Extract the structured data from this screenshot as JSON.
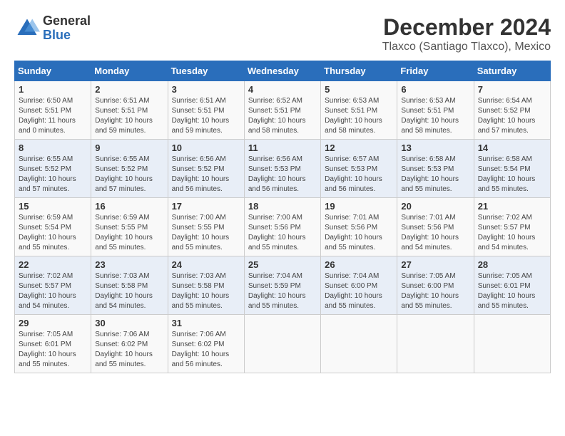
{
  "logo": {
    "general": "General",
    "blue": "Blue"
  },
  "title": "December 2024",
  "subtitle": "Tlaxco (Santiago Tlaxco), Mexico",
  "calendar": {
    "headers": [
      "Sunday",
      "Monday",
      "Tuesday",
      "Wednesday",
      "Thursday",
      "Friday",
      "Saturday"
    ],
    "weeks": [
      [
        {
          "day": "1",
          "sunrise": "6:50 AM",
          "sunset": "5:51 PM",
          "daylight": "11 hours and 0 minutes."
        },
        {
          "day": "2",
          "sunrise": "6:51 AM",
          "sunset": "5:51 PM",
          "daylight": "10 hours and 59 minutes."
        },
        {
          "day": "3",
          "sunrise": "6:51 AM",
          "sunset": "5:51 PM",
          "daylight": "10 hours and 59 minutes."
        },
        {
          "day": "4",
          "sunrise": "6:52 AM",
          "sunset": "5:51 PM",
          "daylight": "10 hours and 58 minutes."
        },
        {
          "day": "5",
          "sunrise": "6:53 AM",
          "sunset": "5:51 PM",
          "daylight": "10 hours and 58 minutes."
        },
        {
          "day": "6",
          "sunrise": "6:53 AM",
          "sunset": "5:51 PM",
          "daylight": "10 hours and 58 minutes."
        },
        {
          "day": "7",
          "sunrise": "6:54 AM",
          "sunset": "5:52 PM",
          "daylight": "10 hours and 57 minutes."
        }
      ],
      [
        {
          "day": "8",
          "sunrise": "6:55 AM",
          "sunset": "5:52 PM",
          "daylight": "10 hours and 57 minutes."
        },
        {
          "day": "9",
          "sunrise": "6:55 AM",
          "sunset": "5:52 PM",
          "daylight": "10 hours and 57 minutes."
        },
        {
          "day": "10",
          "sunrise": "6:56 AM",
          "sunset": "5:52 PM",
          "daylight": "10 hours and 56 minutes."
        },
        {
          "day": "11",
          "sunrise": "6:56 AM",
          "sunset": "5:53 PM",
          "daylight": "10 hours and 56 minutes."
        },
        {
          "day": "12",
          "sunrise": "6:57 AM",
          "sunset": "5:53 PM",
          "daylight": "10 hours and 56 minutes."
        },
        {
          "day": "13",
          "sunrise": "6:58 AM",
          "sunset": "5:53 PM",
          "daylight": "10 hours and 55 minutes."
        },
        {
          "day": "14",
          "sunrise": "6:58 AM",
          "sunset": "5:54 PM",
          "daylight": "10 hours and 55 minutes."
        }
      ],
      [
        {
          "day": "15",
          "sunrise": "6:59 AM",
          "sunset": "5:54 PM",
          "daylight": "10 hours and 55 minutes."
        },
        {
          "day": "16",
          "sunrise": "6:59 AM",
          "sunset": "5:55 PM",
          "daylight": "10 hours and 55 minutes."
        },
        {
          "day": "17",
          "sunrise": "7:00 AM",
          "sunset": "5:55 PM",
          "daylight": "10 hours and 55 minutes."
        },
        {
          "day": "18",
          "sunrise": "7:00 AM",
          "sunset": "5:56 PM",
          "daylight": "10 hours and 55 minutes."
        },
        {
          "day": "19",
          "sunrise": "7:01 AM",
          "sunset": "5:56 PM",
          "daylight": "10 hours and 55 minutes."
        },
        {
          "day": "20",
          "sunrise": "7:01 AM",
          "sunset": "5:56 PM",
          "daylight": "10 hours and 54 minutes."
        },
        {
          "day": "21",
          "sunrise": "7:02 AM",
          "sunset": "5:57 PM",
          "daylight": "10 hours and 54 minutes."
        }
      ],
      [
        {
          "day": "22",
          "sunrise": "7:02 AM",
          "sunset": "5:57 PM",
          "daylight": "10 hours and 54 minutes."
        },
        {
          "day": "23",
          "sunrise": "7:03 AM",
          "sunset": "5:58 PM",
          "daylight": "10 hours and 54 minutes."
        },
        {
          "day": "24",
          "sunrise": "7:03 AM",
          "sunset": "5:58 PM",
          "daylight": "10 hours and 55 minutes."
        },
        {
          "day": "25",
          "sunrise": "7:04 AM",
          "sunset": "5:59 PM",
          "daylight": "10 hours and 55 minutes."
        },
        {
          "day": "26",
          "sunrise": "7:04 AM",
          "sunset": "6:00 PM",
          "daylight": "10 hours and 55 minutes."
        },
        {
          "day": "27",
          "sunrise": "7:05 AM",
          "sunset": "6:00 PM",
          "daylight": "10 hours and 55 minutes."
        },
        {
          "day": "28",
          "sunrise": "7:05 AM",
          "sunset": "6:01 PM",
          "daylight": "10 hours and 55 minutes."
        }
      ],
      [
        {
          "day": "29",
          "sunrise": "7:05 AM",
          "sunset": "6:01 PM",
          "daylight": "10 hours and 55 minutes."
        },
        {
          "day": "30",
          "sunrise": "7:06 AM",
          "sunset": "6:02 PM",
          "daylight": "10 hours and 55 minutes."
        },
        {
          "day": "31",
          "sunrise": "7:06 AM",
          "sunset": "6:02 PM",
          "daylight": "10 hours and 56 minutes."
        },
        null,
        null,
        null,
        null
      ]
    ]
  }
}
